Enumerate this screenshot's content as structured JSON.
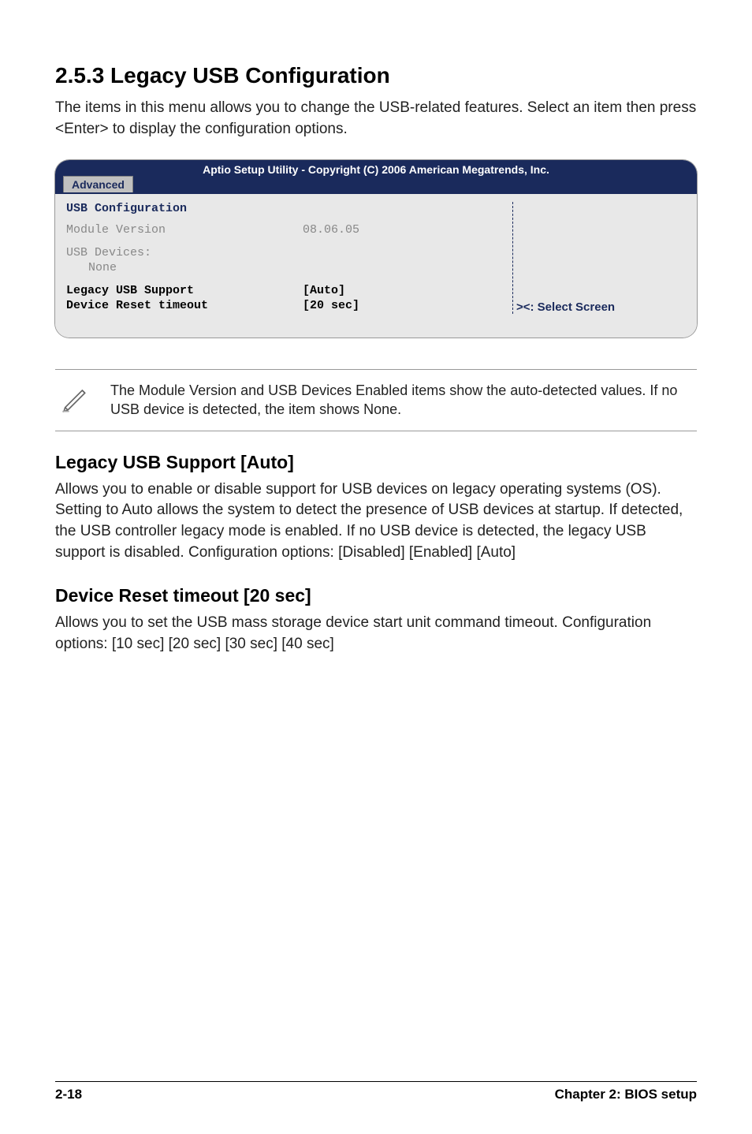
{
  "heading": "2.5.3   Legacy USB Configuration",
  "intro": "The items in this menu allows you to change the USB-related features. Select an item then press <Enter> to display the configuration options.",
  "bios": {
    "header": "Aptio Setup Utility - Copyright (C) 2006 American Megatrends, Inc.",
    "tab": "Advanced",
    "title": "USB Configuration",
    "module_label": "Module Version",
    "module_value": "08.06.05",
    "devices_label": "USB Devices:",
    "devices_value": "None",
    "legacy_label": "Legacy USB Support",
    "legacy_value": "[Auto]",
    "reset_label": "Device Reset timeout",
    "reset_value": "[20 sec]",
    "select_screen": "><: Select Screen"
  },
  "note": "The Module Version and USB Devices Enabled items show the auto-detected values. If no USB device is detected, the item shows None.",
  "legacy_heading": "Legacy USB Support [Auto]",
  "legacy_body": "Allows you to enable or disable support for USB devices on legacy operating systems (OS). Setting to Auto allows the system to detect the presence of USB devices at startup. If detected, the USB controller legacy mode is enabled. If no USB device is detected, the legacy USB support is disabled. Configuration options: [Disabled] [Enabled] [Auto]",
  "device_heading": "Device Reset timeout [20 sec]",
  "device_body": "Allows you to set the USB mass storage device start unit command timeout. Configuration options: [10 sec] [20 sec] [30 sec] [40 sec]",
  "footer_left": "2-18",
  "footer_right": "Chapter 2: BIOS setup"
}
